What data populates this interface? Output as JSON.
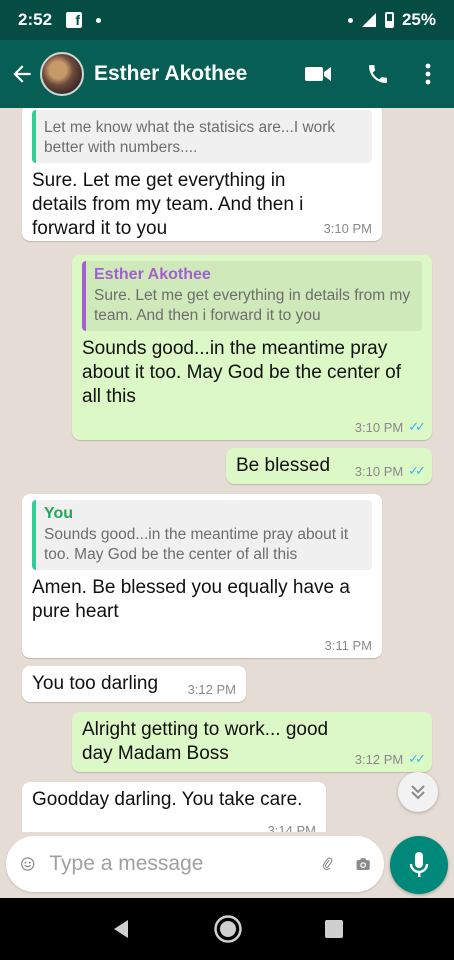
{
  "status_bar": {
    "time": "2:52",
    "fb": "f",
    "battery": "25%"
  },
  "header": {
    "contact_name": "Esther Akothee"
  },
  "messages": [
    {
      "dir": "in",
      "quote_text": "Let me know what the statisics are...I work better with numbers....",
      "text": "Sure. Let me get everything in details from my team. And then i forward it to you",
      "time": "3:10 PM"
    },
    {
      "dir": "out",
      "quote_author": "Esther Akothee",
      "quote_text": "Sure. Let me get everything in details from my team. And then i forward it to you",
      "text": "Sounds good...in the meantime pray about it too. May God be the center of all this",
      "time": "3:10 PM"
    },
    {
      "dir": "out",
      "text": "Be blessed",
      "time": "3:10 PM"
    },
    {
      "dir": "in",
      "quote_author": "You",
      "quote_text": "Sounds good...in the meantime pray about it too. May God be the center of all this",
      "text": "Amen. Be blessed you equally have a pure heart",
      "time": "3:11 PM"
    },
    {
      "dir": "in",
      "text": "You too darling",
      "time": "3:12 PM"
    },
    {
      "dir": "out",
      "text": "Alright getting to work... good day Madam Boss",
      "time": "3:12 PM"
    },
    {
      "dir": "in",
      "text": "Goodday darling. You take care.",
      "time": "3:14 PM"
    }
  ],
  "composer": {
    "placeholder": "Type a message"
  },
  "icons": {
    "back": "arrow-left-icon",
    "video": "video-camera-icon",
    "call": "phone-icon",
    "menu": "more-vert-icon",
    "emoji": "emoji-icon",
    "attach": "paperclip-icon",
    "camera": "camera-icon",
    "mic": "microphone-icon",
    "scroll": "double-chevron-down-icon"
  },
  "colors": {
    "header": "#075e54",
    "status": "#054d44",
    "incoming": "#ffffff",
    "outgoing": "#dcf8c6",
    "fab": "#00897b",
    "read_ticks": "#34b7f1"
  }
}
